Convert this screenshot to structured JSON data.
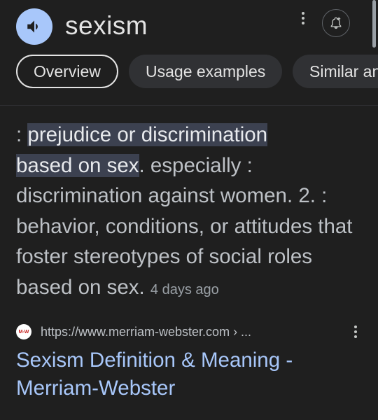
{
  "header": {
    "word": "sexism",
    "speaker_icon": "speaker-icon",
    "menu_icon": "vertical-dots-icon",
    "alert_icon": "bell-plus-icon"
  },
  "tabs": [
    {
      "label": "Overview",
      "active": true
    },
    {
      "label": "Usage examples",
      "active": false
    },
    {
      "label": "Similar and opposite words",
      "active": false
    }
  ],
  "definition": {
    "prefix": ": ",
    "highlight_1": "prejudice or discrimination",
    "highlight_2": "based on sex",
    "rest": ". especially : discrimination against women. 2. : behavior, conditions, or attitudes that foster stereotypes of social roles based on sex.",
    "time_ago": "4 days ago"
  },
  "source": {
    "favicon_text": "M-W",
    "url": "https://www.merriam-webster.com › ..."
  },
  "result": {
    "title": "Sexism Definition & Meaning - Merriam-Webster"
  },
  "colors": {
    "background": "#1f1f1f",
    "link": "#a8c7fa",
    "highlight": "#3c4150",
    "chip": "#303134"
  }
}
